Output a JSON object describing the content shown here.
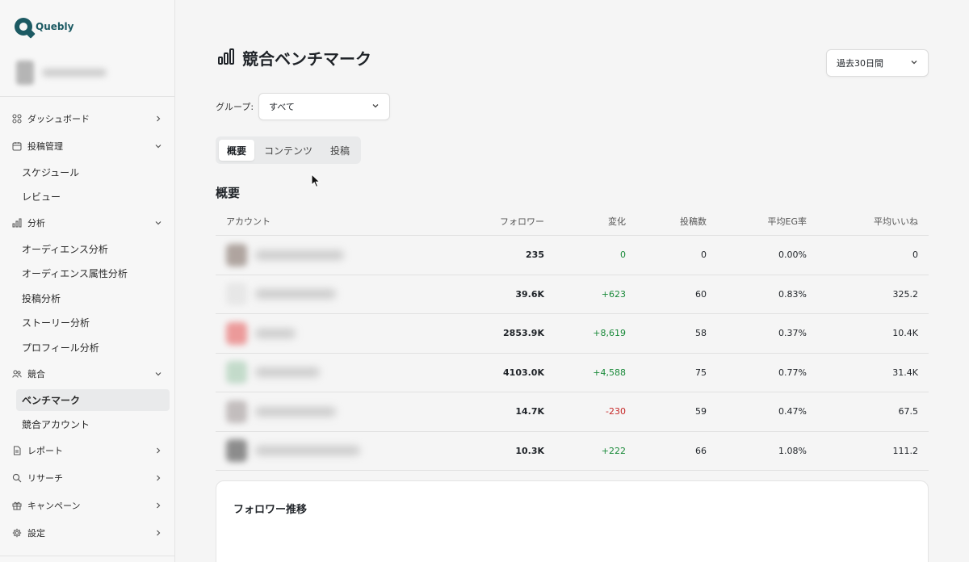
{
  "app": {
    "name": "Quebly"
  },
  "sidebar": {
    "items": [
      {
        "label": "ダッシュボード",
        "icon": "grid-icon",
        "chevron": "right"
      },
      {
        "label": "投稿管理",
        "icon": "calendar-icon",
        "chevron": "down",
        "children": [
          {
            "label": "スケジュール"
          },
          {
            "label": "レビュー"
          }
        ]
      },
      {
        "label": "分析",
        "icon": "bar-chart-icon",
        "chevron": "down",
        "children": [
          {
            "label": "オーディエンス分析"
          },
          {
            "label": "オーディエンス属性分析"
          },
          {
            "label": "投稿分析"
          },
          {
            "label": "ストーリー分析"
          },
          {
            "label": "プロフィール分析"
          }
        ]
      },
      {
        "label": "競合",
        "icon": "users-icon",
        "chevron": "down",
        "children": [
          {
            "label": "ベンチマーク",
            "active": true
          },
          {
            "label": "競合アカウント"
          }
        ]
      },
      {
        "label": "レポート",
        "icon": "document-icon",
        "chevron": "right"
      },
      {
        "label": "リサーチ",
        "icon": "search-icon",
        "chevron": "right"
      },
      {
        "label": "キャンペーン",
        "icon": "gift-icon",
        "chevron": "right"
      },
      {
        "label": "設定",
        "icon": "gear-icon",
        "chevron": "right"
      }
    ]
  },
  "header": {
    "title": "競合ベンチマーク",
    "period": "過去30日間"
  },
  "filter": {
    "group_label": "グループ:",
    "group_value": "すべて"
  },
  "tabs": [
    {
      "label": "概要",
      "active": true
    },
    {
      "label": "コンテンツ",
      "active": false
    },
    {
      "label": "投稿",
      "active": false
    }
  ],
  "overview": {
    "title": "概要",
    "columns": [
      "アカウント",
      "フォロワー",
      "変化",
      "投稿数",
      "平均EG率",
      "平均いいね"
    ],
    "rows": [
      {
        "followers": "235",
        "change": "0",
        "posts": "0",
        "eg": "0.00%",
        "likes": "0",
        "avatar_color": "#8a7a72"
      },
      {
        "followers": "39.6K",
        "change": "+623",
        "posts": "60",
        "eg": "0.83%",
        "likes": "325.2",
        "avatar_color": "#e0e0e0"
      },
      {
        "followers": "2853.9K",
        "change": "+8,619",
        "posts": "58",
        "eg": "0.37%",
        "likes": "10.4K",
        "avatar_color": "#e76a6a"
      },
      {
        "followers": "4103.0K",
        "change": "+4,588",
        "posts": "75",
        "eg": "0.77%",
        "likes": "31.4K",
        "avatar_color": "#a9cdb4"
      },
      {
        "followers": "14.7K",
        "change": "-230",
        "posts": "59",
        "eg": "0.47%",
        "likes": "67.5",
        "avatar_color": "#a8a0a0"
      },
      {
        "followers": "10.3K",
        "change": "+222",
        "posts": "66",
        "eg": "1.08%",
        "likes": "111.2",
        "avatar_color": "#555555"
      }
    ]
  },
  "follower_trend": {
    "title": "フォロワー推移"
  },
  "colors": {
    "brand": "#1c5a63",
    "positive": "#1a8a3a",
    "negative": "#c62828"
  }
}
